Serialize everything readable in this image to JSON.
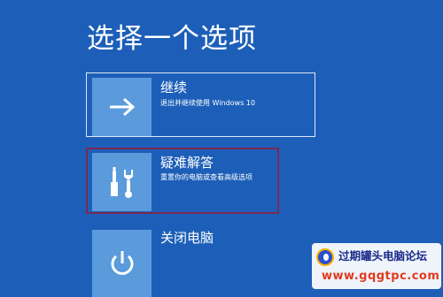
{
  "page": {
    "title": "选择一个选项"
  },
  "options": [
    {
      "label": "继续",
      "description": "退出并继续使用 Windows 10",
      "icon": "arrow-right-icon"
    },
    {
      "label": "疑难解答",
      "description": "重置你的电脑或查看高级选项",
      "icon": "wrench-screwdriver-icon"
    },
    {
      "label": "关闭电脑",
      "description": "",
      "icon": "power-icon"
    }
  ],
  "watermark": {
    "name": "过期罐头电脑论坛",
    "url": "www.gqgtpc.com"
  },
  "colors": {
    "background": "#1d5fb8",
    "tile": "#5b9bdc",
    "selection_border": "#7a2a52"
  }
}
